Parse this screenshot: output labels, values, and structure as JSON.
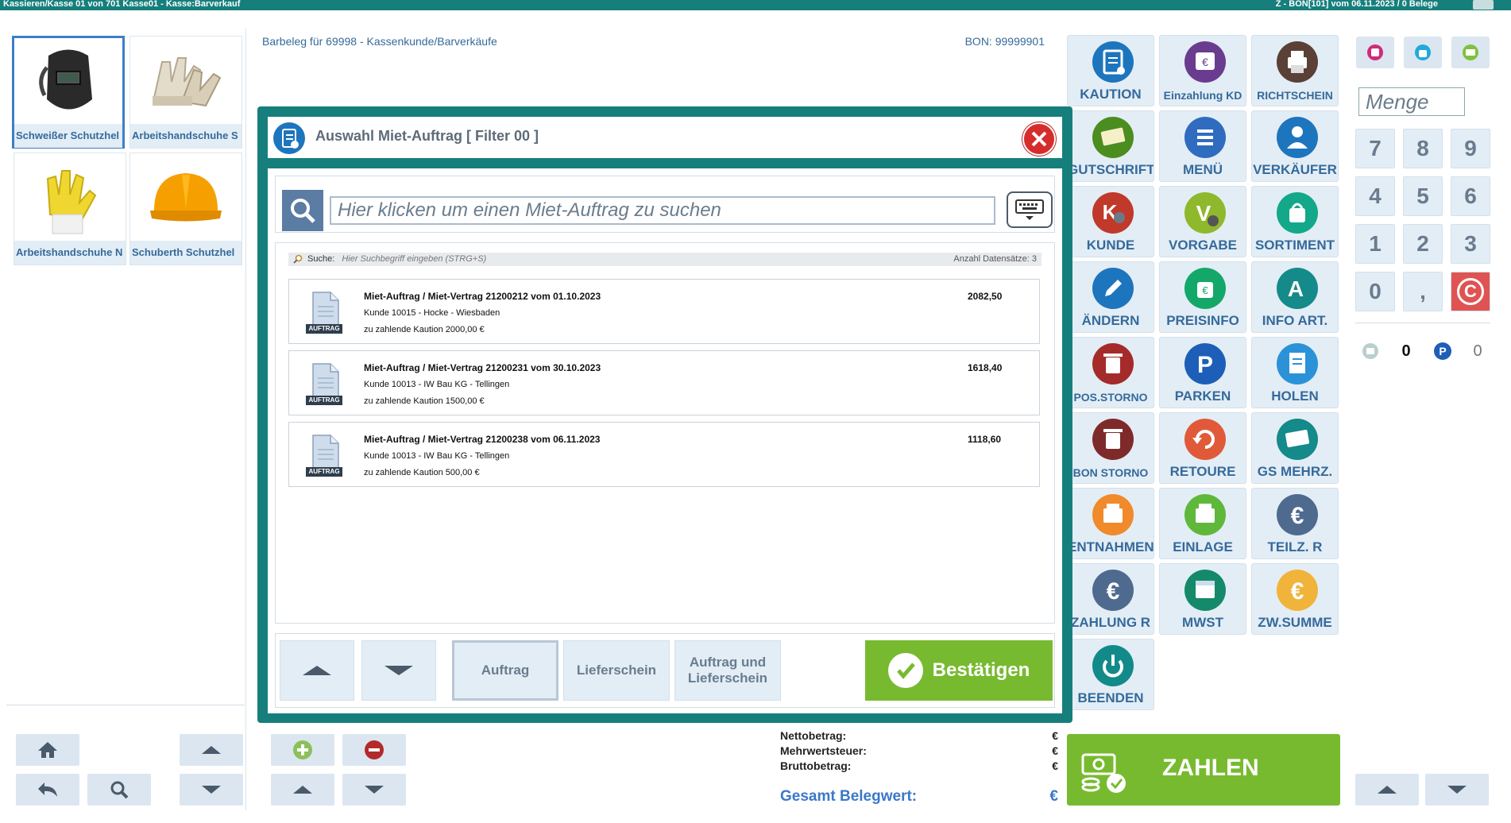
{
  "window": {
    "title_left": "Kassieren/Kasse 01 von 701 Kasse01 - Kasse:Barverkauf",
    "title_right": "Z - BON[101] vom 06.11.2023 / 0 Belege"
  },
  "products": [
    {
      "label": "Schweißer Schutzhel",
      "icon": "welding-helmet-icon",
      "selected": true
    },
    {
      "label": "Arbeitshandschuhe S",
      "icon": "work-gloves-icon",
      "selected": false
    },
    {
      "label": "Arbeitshandschuhe N",
      "icon": "yellow-gloves-icon",
      "selected": false
    },
    {
      "label": "Schuberth Schutzhel",
      "icon": "hard-hat-icon",
      "selected": false
    }
  ],
  "receipt": {
    "header": "Barbeleg für 69998 - Kassenkunde/Barverkäufe",
    "bon": "BON: 99999901"
  },
  "totals": {
    "netto_label": "Nettobetrag:",
    "mwst_label": "Mehrwertsteuer:",
    "brutto_label": "Bruttobetrag:",
    "currency": "€",
    "gesamt_label": "Gesamt Belegwert:"
  },
  "tiles": [
    {
      "label": "KAUTION",
      "icon": "clipboard-icon",
      "color": "#1d75bd",
      "small": false
    },
    {
      "label": "Einzahlung KD",
      "icon": "deposit-icon",
      "color": "#6a3c8f",
      "small": true
    },
    {
      "label": "RICHTSCHEIN",
      "icon": "printer-icon",
      "color": "#5a4036",
      "small": true
    },
    {
      "label": "GUTSCHRIFT",
      "icon": "voucher-icon",
      "color": "#4b8d1f",
      "small": false
    },
    {
      "label": "MENÜ",
      "icon": "menu-icon",
      "color": "#2f6cbf",
      "small": false
    },
    {
      "label": "VERKÄUFER",
      "icon": "seller-icon",
      "color": "#1d75bd",
      "small": false
    },
    {
      "label": "KUNDE",
      "icon": "customer-icon",
      "color": "#c0392b",
      "small": false
    },
    {
      "label": "VORGABE",
      "icon": "defaults-icon",
      "color": "#8fb82c",
      "small": false
    },
    {
      "label": "SORTIMENT",
      "icon": "bag-icon",
      "color": "#13a88a",
      "small": false
    },
    {
      "label": "ÄNDERN",
      "icon": "pencil-icon",
      "color": "#1d75bd",
      "small": false
    },
    {
      "label": "PREISINFO",
      "icon": "price-info-icon",
      "color": "#13a86a",
      "small": false
    },
    {
      "label": "INFO ART.",
      "icon": "article-info-icon",
      "color": "#158a8a",
      "small": false
    },
    {
      "label": "POS.STORNO",
      "icon": "trash-icon",
      "color": "#a52a2a",
      "small": true
    },
    {
      "label": "PARKEN",
      "icon": "parking-icon",
      "color": "#1d5fb8",
      "small": false
    },
    {
      "label": "HOLEN",
      "icon": "receipt-fetch-icon",
      "color": "#2b92d8",
      "small": false
    },
    {
      "label": "BON STORNO",
      "icon": "bin-receipt-icon",
      "color": "#7f2a2a",
      "small": true
    },
    {
      "label": "RETOURE",
      "icon": "return-icon",
      "color": "#e05a3a",
      "small": false
    },
    {
      "label": "GS MEHRZ.",
      "icon": "multi-voucher-icon",
      "color": "#148a8a",
      "small": false
    },
    {
      "label": "ENTNAHMEN",
      "icon": "cash-out-icon",
      "color": "#f08a2a",
      "small": false
    },
    {
      "label": "EINLAGE",
      "icon": "cash-in-icon",
      "color": "#5fb83a",
      "small": false
    },
    {
      "label": "TEILZ. R",
      "icon": "euro-icon",
      "color": "#4f6a8f",
      "small": false
    },
    {
      "label": "ZAHLUNG R",
      "icon": "euro-payment-icon",
      "color": "#4f6a8f",
      "small": false
    },
    {
      "label": "MWST",
      "icon": "calendar-percent-icon",
      "color": "#148a6a",
      "small": false
    },
    {
      "label": "ZW.SUMME",
      "icon": "euro-subtotal-icon",
      "color": "#f0b43a",
      "small": false
    },
    {
      "label": "BEENDEN",
      "icon": "power-icon",
      "color": "#138a8a",
      "small": false
    }
  ],
  "zahlen": {
    "label": "ZAHLEN"
  },
  "keypad": {
    "menge_placeholder": "Menge",
    "keys": [
      "7",
      "8",
      "9",
      "4",
      "5",
      "6",
      "1",
      "2",
      "3",
      "0",
      ",",
      "C"
    ],
    "counter_left": "0",
    "counter_right": "0"
  },
  "dialog": {
    "title": "Auswahl Miet-Auftrag [ Filter 00 ]",
    "search_placeholder": "Hier klicken um einen Miet-Auftrag zu suchen",
    "filter_label": "Suche:",
    "filter_hint": "Hier Suchbegriff eingeben (STRG+S)",
    "count_label": "Anzahl Datensätze: 3",
    "doc_badge": "AUFTRAG",
    "orders": [
      {
        "title": "Miet-Auftrag / Miet-Vertrag 21200212 vom 01.10.2023",
        "customer": "Kunde 10015 - Hocke - Wiesbaden",
        "deposit": "zu zahlende Kaution 2000,00 €",
        "amount": "2082,50"
      },
      {
        "title": "Miet-Auftrag / Miet-Vertrag 21200231 vom 30.10.2023",
        "customer": "Kunde 10013 - IW Bau KG - Tellingen",
        "deposit": "zu zahlende Kaution 1500,00 €",
        "amount": "1618,40"
      },
      {
        "title": "Miet-Auftrag / Miet-Vertrag 21200238 vom 06.11.2023",
        "customer": "Kunde 10013 - IW Bau KG - Tellingen",
        "deposit": "zu zahlende Kaution 500,00 €",
        "amount": "1118,60"
      }
    ],
    "btn_auftrag": "Auftrag",
    "btn_lieferschein": "Lieferschein",
    "btn_auftrag_und_l1": "Auftrag und",
    "btn_auftrag_und_l2": "Lieferschein",
    "btn_confirm": "Bestätigen"
  }
}
